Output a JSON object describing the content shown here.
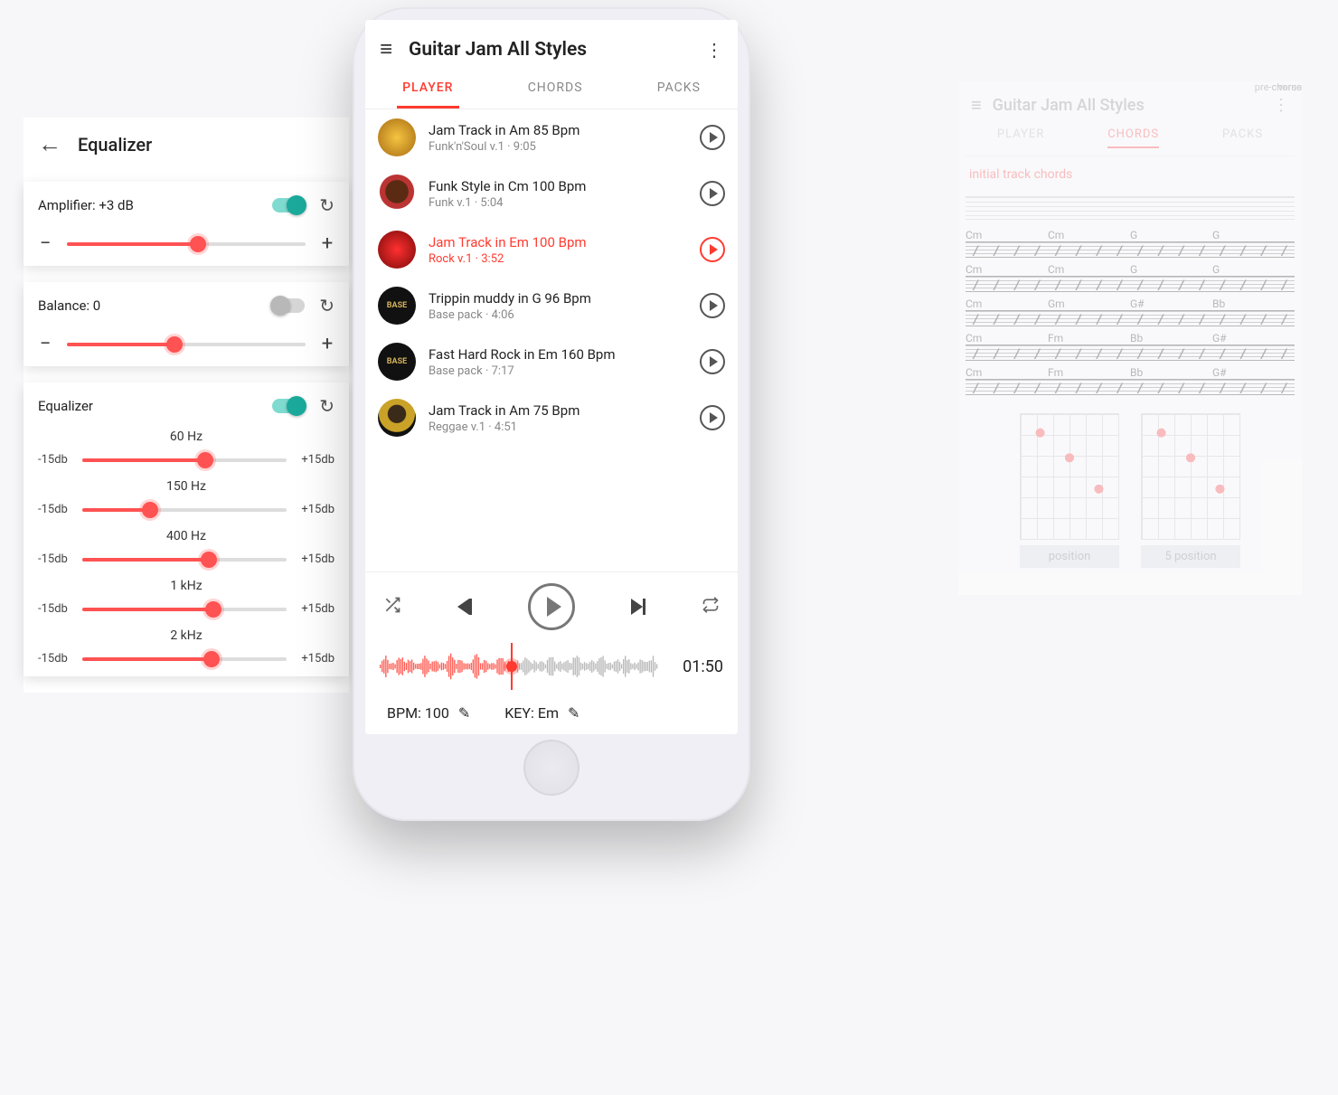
{
  "equalizer": {
    "title": "Equalizer",
    "amp_card": {
      "label": "Amplifier: +3 dB",
      "enabled": true,
      "value_pct": 55
    },
    "bal_card": {
      "label": "Balance: 0",
      "enabled": false,
      "value_pct": 45
    },
    "eq_card": {
      "label": "Equalizer",
      "enabled": true,
      "min_label": "-15db",
      "max_label": "+15db",
      "bands": [
        {
          "freq": "60 Hz",
          "pct": 60
        },
        {
          "freq": "150 Hz",
          "pct": 33
        },
        {
          "freq": "400 Hz",
          "pct": 62
        },
        {
          "freq": "1 kHz",
          "pct": 64
        },
        {
          "freq": "2 kHz",
          "pct": 63
        }
      ]
    }
  },
  "player": {
    "title": "Guitar Jam All Styles",
    "tabs": [
      "PLAYER",
      "CHORDS",
      "PACKS"
    ],
    "active_tab": 0,
    "tracks": [
      {
        "title": "Jam Track in Am 85 Bpm",
        "sub": "Funk'n'Soul v.1  ·  9:05",
        "art": "yellow",
        "selected": false
      },
      {
        "title": "Funk Style in Cm 100 Bpm",
        "sub": "Funk v.1  ·  5:04",
        "art": "afro",
        "selected": false
      },
      {
        "title": "Jam Track in Em 100 Bpm",
        "sub": "Rock v.1  ·  3:52",
        "art": "red",
        "selected": true
      },
      {
        "title": "Trippin muddy in G 96 Bpm",
        "sub": "Base pack  ·  4:06",
        "art": "base",
        "selected": false,
        "art_text": "BASE"
      },
      {
        "title": "Fast Hard Rock in Em 160 Bpm",
        "sub": "Base pack  ·  7:17",
        "art": "base",
        "selected": false,
        "art_text": "BASE"
      },
      {
        "title": "Jam Track in Am 75 Bpm",
        "sub": "Reggae v.1  ·  4:51",
        "art": "reggae",
        "selected": false
      }
    ],
    "current_time": "01:50",
    "progress_pct": 47,
    "bpm_label": "BPM: 100",
    "key_label": "KEY: Em"
  },
  "chords": {
    "title": "Guitar Jam All Styles",
    "active_tab": "CHORDS",
    "link": "initial track chords",
    "lines": [
      {
        "chords": [
          "Cm",
          "Cm",
          "G",
          "G"
        ],
        "tag": "verse"
      },
      {
        "chords": [
          "Cm",
          "Cm",
          "G",
          "G"
        ],
        "tag": ""
      },
      {
        "chords": [
          "Cm",
          "Gm",
          "G#",
          "Bb"
        ],
        "tag": "pre-chorus"
      },
      {
        "chords": [
          "Cm",
          "Fm",
          "Bb",
          "G#"
        ],
        "tag": "chorus"
      },
      {
        "chords": [
          "Cm",
          "Fm",
          "Bb",
          "G#"
        ],
        "tag": ""
      }
    ],
    "positions": [
      "position",
      "5 position"
    ]
  }
}
